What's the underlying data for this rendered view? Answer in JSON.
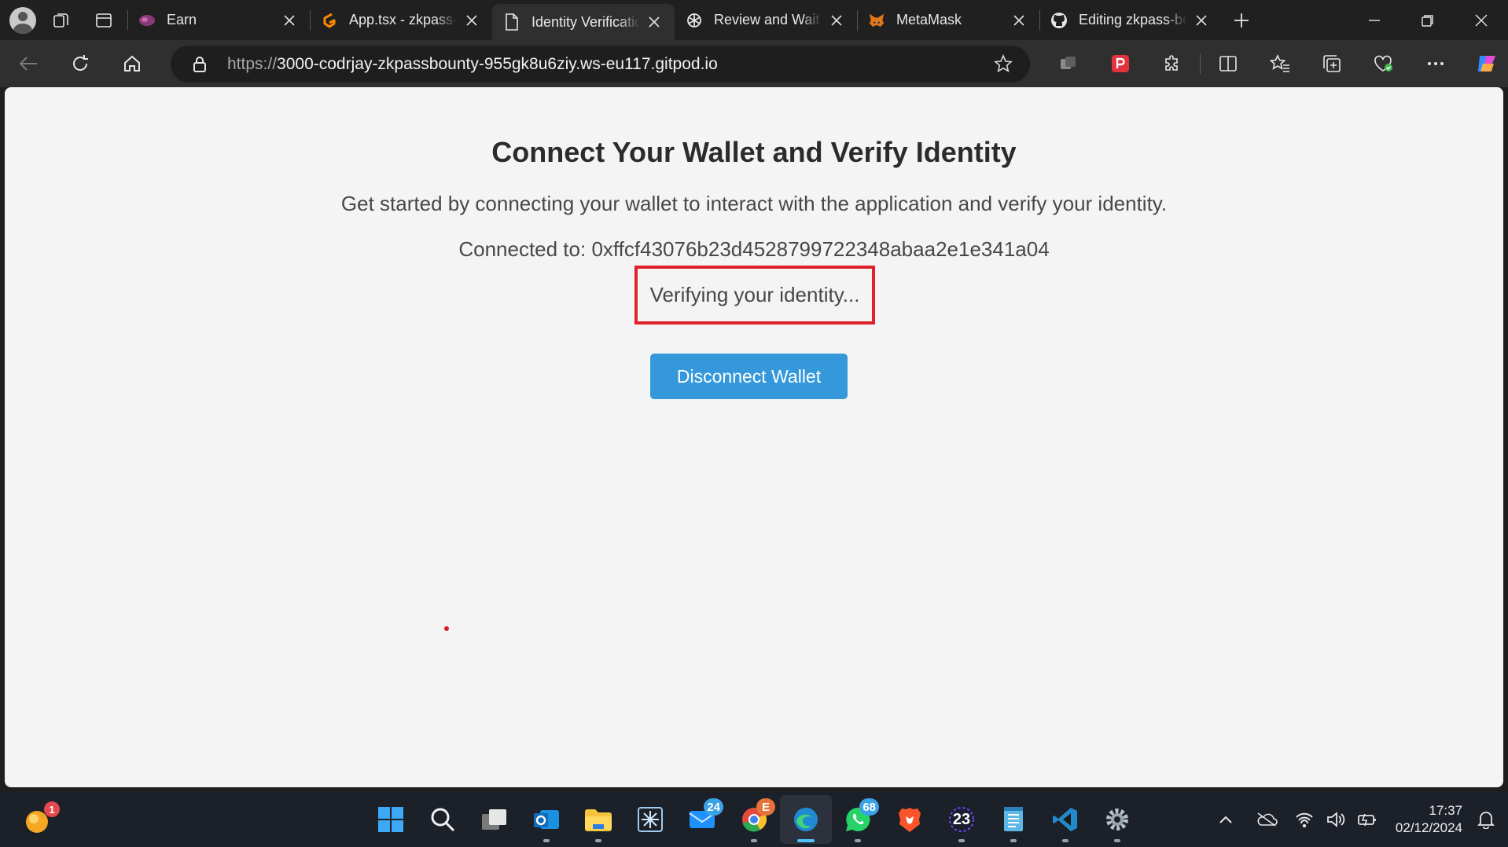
{
  "browser": {
    "tabs": [
      {
        "title": "Earn",
        "icon": "earn-favicon",
        "active": false
      },
      {
        "title": "App.tsx - zkpass-bounty",
        "icon": "gitpod-favicon",
        "active": false
      },
      {
        "title": "Identity Verification",
        "icon": "page-favicon",
        "active": true
      },
      {
        "title": "Review and Wait",
        "icon": "chatgpt-favicon",
        "active": false
      },
      {
        "title": "MetaMask",
        "icon": "metamask-favicon",
        "active": false
      },
      {
        "title": "Editing zkpass-bounty",
        "icon": "github-favicon",
        "active": false
      }
    ],
    "address": {
      "scheme": "https://",
      "host": "3000-codrjay-zkpassbounty-955gk8u6ziy.ws-eu117.gitpod.io"
    }
  },
  "page": {
    "title": "Connect Your Wallet and Verify Identity",
    "subtitle": "Get started by connecting your wallet to interact with the application and verify your identity.",
    "connected": "Connected to: 0xffcf43076b23d4528799722348abaa2e1e341a04",
    "status": "Verifying your identity...",
    "disconnect_label": "Disconnect Wallet"
  },
  "colors": {
    "accent_button": "#3498db",
    "highlight_box": "#e0202a"
  },
  "taskbar": {
    "notification_count": "1",
    "mail_badge": "24",
    "chrome_badge": "E",
    "whatsapp_badge": "68",
    "app_23_label": "23",
    "time": "17:37",
    "date": "02/12/2024"
  }
}
